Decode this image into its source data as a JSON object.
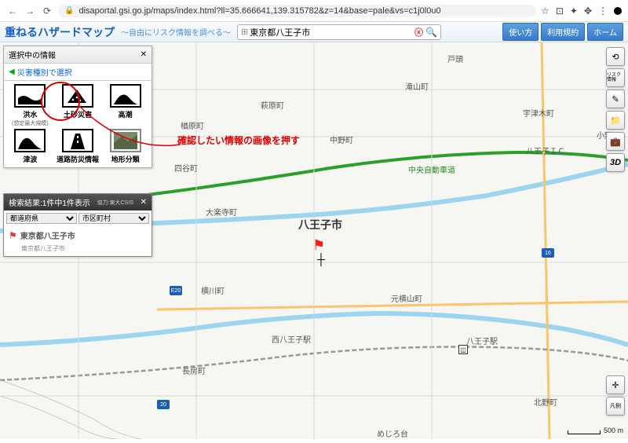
{
  "browser": {
    "url": "disaportal.gsi.go.jp/maps/index.html?ll=35.666641,139.315782&z=14&base=pale&vs=c1j0l0u0"
  },
  "header": {
    "title": "重ねるハザードマップ",
    "subtitle": "～自由にリスク情報を調べる～",
    "search_value": "東京都八王子市"
  },
  "hdr_buttons": [
    "使い方",
    "利用規約",
    "ホーム"
  ],
  "panel": {
    "title": "選択中の情報",
    "tab": "災害種別で選択"
  },
  "hazards": [
    {
      "name": "洪水",
      "sub": "(想定最大規模)"
    },
    {
      "name": "土砂災害",
      "sub": ""
    },
    {
      "name": "高潮",
      "sub": ""
    },
    {
      "name": "津波",
      "sub": ""
    },
    {
      "name": "道路防災情報",
      "sub": ""
    },
    {
      "name": "地形分類",
      "sub": ""
    }
  ],
  "annotation": "確認したい情報の画像を押す",
  "panel2": {
    "title": "検索結果:1件中1件表示",
    "credit": "協力:東大CSIS",
    "sel1": "都道府県",
    "sel2": "市区町村",
    "result_name": "東京都八王子市",
    "result_sub": "東京都八王子市"
  },
  "tools": {
    "reset": "⟲",
    "risk": "リスク情報",
    "pencil": "✎",
    "folder": "📁",
    "bag": "💼",
    "threed": "3D",
    "cross": "✛",
    "layers": "凡例"
  },
  "scale": {
    "label": "500 m"
  },
  "labels": {
    "hachioji": "八王子市",
    "yokokawa": "横川町",
    "otsu": "大楽寺町",
    "yotsuya": "四谷町",
    "hagi": "萩原町",
    "nagabusa": "長房町",
    "nakano": "中野町",
    "takiyama": "滝山町",
    "togashira": "戸頭",
    "uzu": "宇津木町",
    "ono": "小野",
    "chuo": "中央自動車道",
    "ic": "八王子ＩＣ",
    "nishi_sta": "西八王子駅",
    "hachi_sta": "八王子駅",
    "motoyoko": "元横山町",
    "kitano": "北野町",
    "mejiro": "めじろ台",
    "narahara": "楢原町",
    "e20": "E20",
    "r16": "16",
    "r20": "20"
  }
}
